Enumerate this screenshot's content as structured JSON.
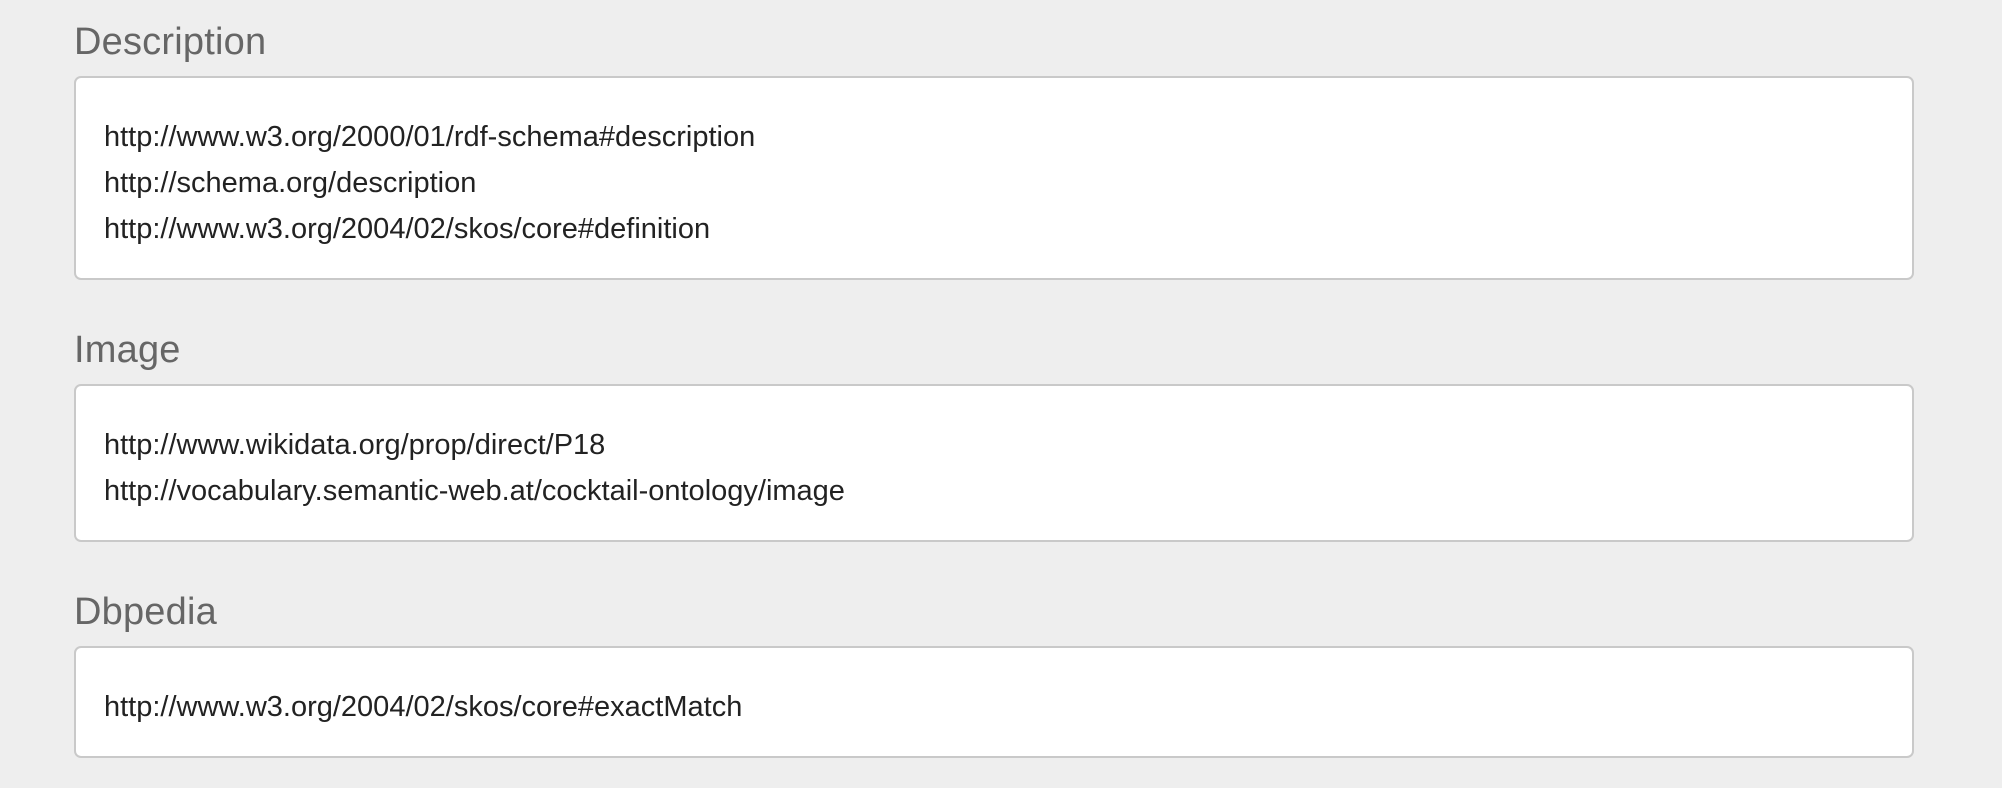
{
  "sections": [
    {
      "label": "Description",
      "values": [
        "http://www.w3.org/2000/01/rdf-schema#description",
        "http://schema.org/description",
        "http://www.w3.org/2004/02/skos/core#definition"
      ]
    },
    {
      "label": "Image",
      "values": [
        "http://www.wikidata.org/prop/direct/P18",
        "http://vocabulary.semantic-web.at/cocktail-ontology/image"
      ]
    },
    {
      "label": "Dbpedia",
      "values": [
        "http://www.w3.org/2004/02/skos/core#exactMatch"
      ]
    }
  ]
}
